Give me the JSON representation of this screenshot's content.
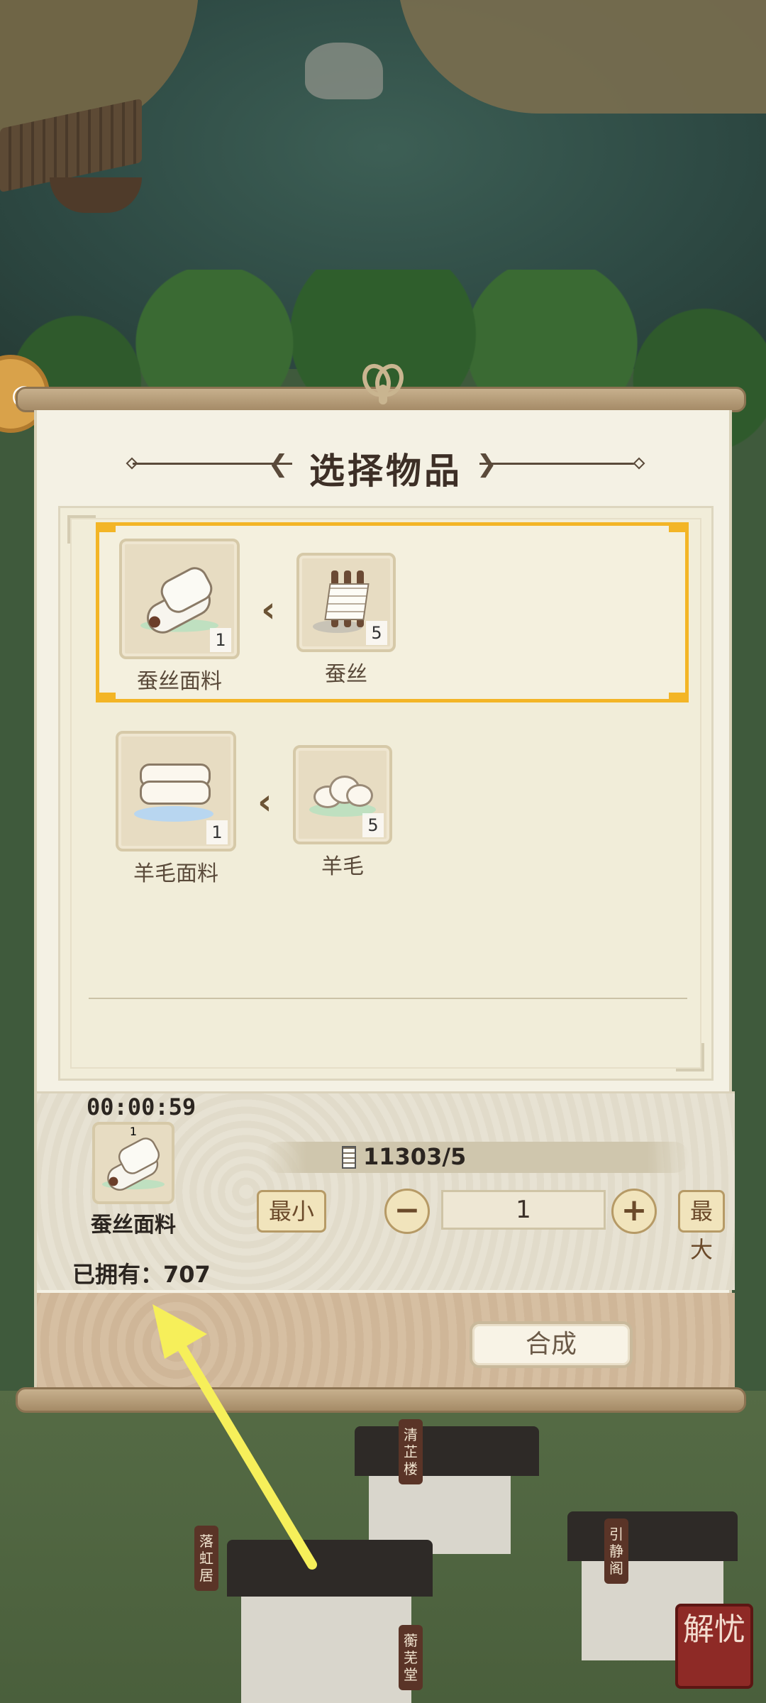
{
  "dialog": {
    "title": "选择物品"
  },
  "recipes": [
    {
      "output": {
        "name": "蚕丝面料",
        "count": "1",
        "icon": "silk-fabric-icon"
      },
      "input": {
        "name": "蚕丝",
        "count": "5",
        "icon": "silk-icon"
      },
      "selected": true
    },
    {
      "output": {
        "name": "羊毛面料",
        "count": "1",
        "icon": "wool-fabric-icon"
      },
      "input": {
        "name": "羊毛",
        "count": "5",
        "icon": "wool-icon"
      },
      "selected": false
    }
  ],
  "craft_panel": {
    "timer": "00:00:59",
    "selected_item": {
      "name": "蚕丝面料",
      "count": "1"
    },
    "owned": "已拥有：707",
    "cost": "11303/5",
    "min_label": "最小",
    "max_label": "最大",
    "minus": "−",
    "plus": "+",
    "quantity": "1",
    "craft_label": "合成"
  },
  "buildings": [
    "清芷楼",
    "落虹居",
    "引静阁",
    "蘅芜堂"
  ],
  "corner_badge": "解忧",
  "colors": {
    "selection": "#f3b526",
    "paper": "#f4f1e4",
    "annotation_arrow": "#f6ef5a"
  }
}
